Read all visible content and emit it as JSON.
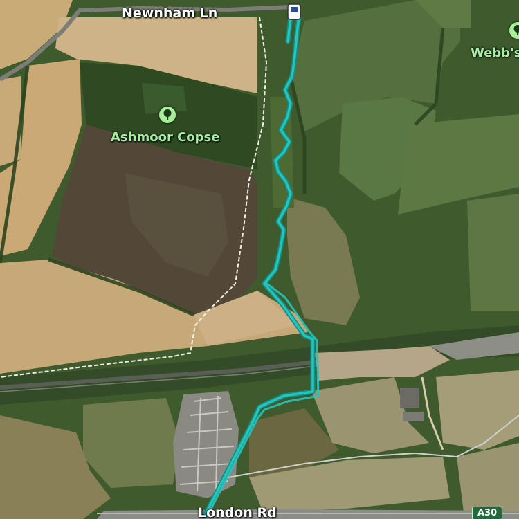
{
  "map": {
    "labels": {
      "road_top": "Newnham Ln",
      "road_bottom": "London Rd",
      "road_shield": "A30"
    },
    "pois": [
      {
        "name": "Ashmoor Copse",
        "icon": "tree-icon"
      },
      {
        "name": "Webb's",
        "icon": "tree-icon"
      }
    ],
    "colors": {
      "route": "#27c4bb",
      "route_outline": "#0f8f88",
      "poi": "#a8ef9a",
      "shield_bg": "#1f6b3a"
    }
  }
}
